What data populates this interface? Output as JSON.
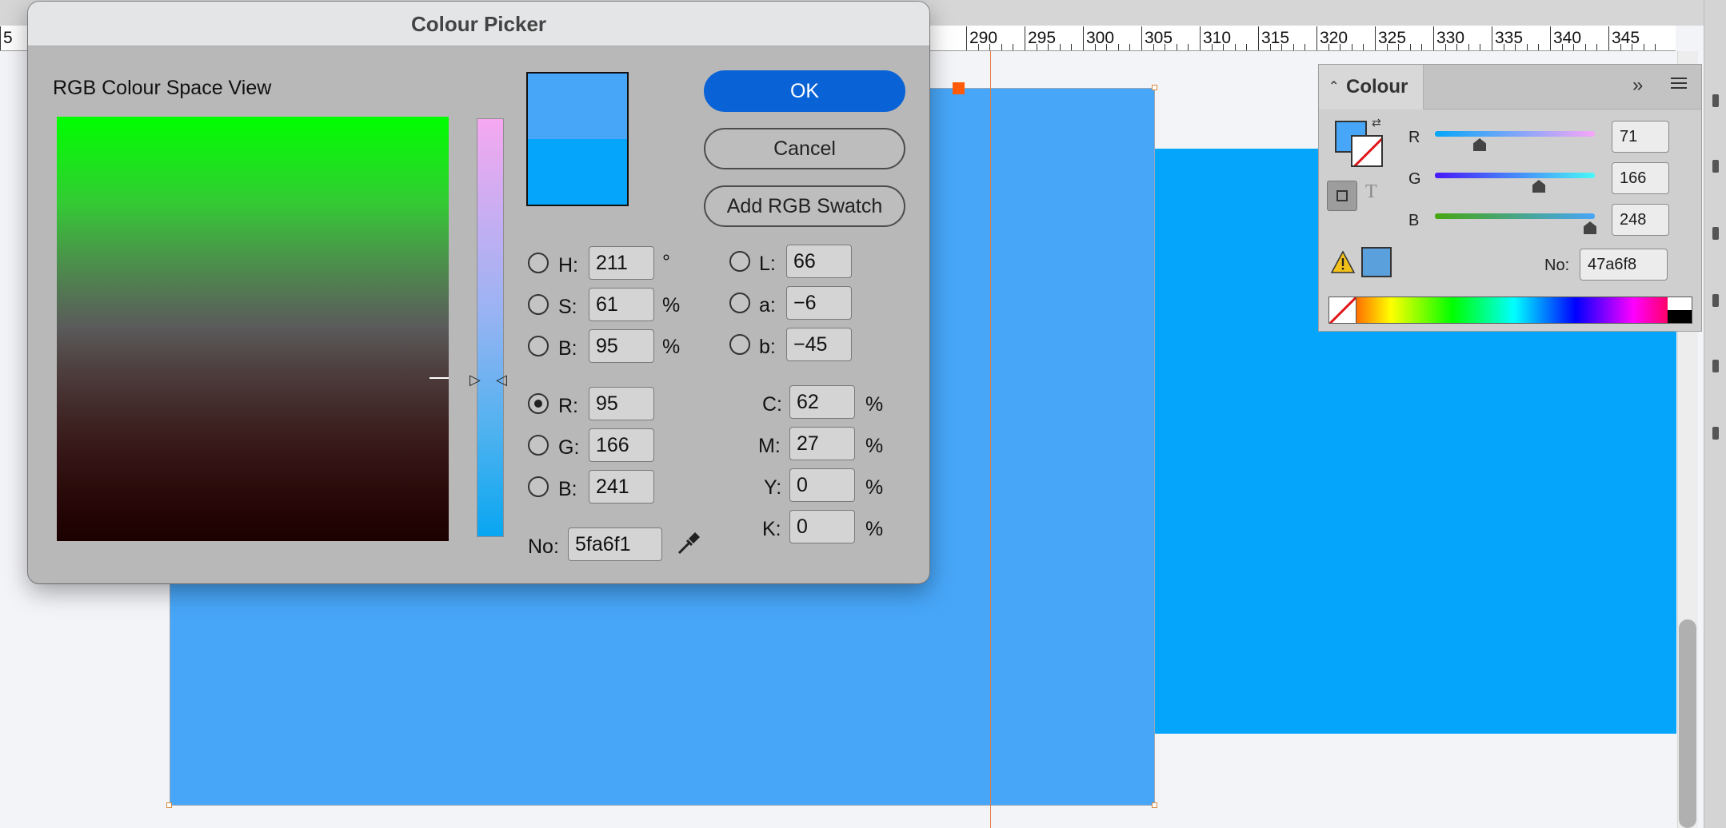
{
  "ruler": {
    "labels": [
      "5",
      "290",
      "295",
      "300",
      "305",
      "310",
      "315",
      "320",
      "325",
      "330",
      "335",
      "340",
      "345"
    ]
  },
  "dialog": {
    "title": "Colour Picker",
    "space_view_label": "RGB Colour Space View",
    "buttons": {
      "ok": "OK",
      "cancel": "Cancel",
      "add_swatch": "Add RGB Swatch"
    },
    "preview": {
      "new_color": "#47a6f8",
      "original_color": "#04a5fb"
    },
    "hsb": {
      "h": {
        "label": "H:",
        "value": "211",
        "unit": "°"
      },
      "s": {
        "label": "S:",
        "value": "61",
        "unit": "%"
      },
      "b": {
        "label": "B:",
        "value": "95",
        "unit": "%"
      }
    },
    "rgb": {
      "r": {
        "label": "R:",
        "value": "95"
      },
      "g": {
        "label": "G:",
        "value": "166"
      },
      "b": {
        "label": "B:",
        "value": "241"
      }
    },
    "lab": {
      "l": {
        "label": "L:",
        "value": "66"
      },
      "a": {
        "label": "a:",
        "value": "−6"
      },
      "b": {
        "label": "b:",
        "value": "−45"
      }
    },
    "cmyk": {
      "c": {
        "label": "C:",
        "value": "62",
        "unit": "%"
      },
      "m": {
        "label": "M:",
        "value": "27",
        "unit": "%"
      },
      "y": {
        "label": "Y:",
        "value": "0",
        "unit": "%"
      },
      "k": {
        "label": "K:",
        "value": "0",
        "unit": "%"
      }
    },
    "hex": {
      "label": "No:",
      "value": "5fa6f1"
    },
    "selected_radio": "R"
  },
  "colour_panel": {
    "tab_label": "Colour",
    "fill_color": "#47a6f8",
    "channels": [
      {
        "label": "R",
        "value": "71",
        "level": 0.28
      },
      {
        "label": "G",
        "value": "166",
        "level": 0.65
      },
      {
        "label": "B",
        "value": "248",
        "level": 0.97
      }
    ],
    "gamut_swatch_color": "#5aa0dc",
    "hex": {
      "label": "No:",
      "value": "47a6f8"
    }
  },
  "canvas": {
    "main_shape_color": "#47a6f8",
    "secondary_shape_color": "#04a5fb",
    "accent_color": "#ff5b0a"
  }
}
